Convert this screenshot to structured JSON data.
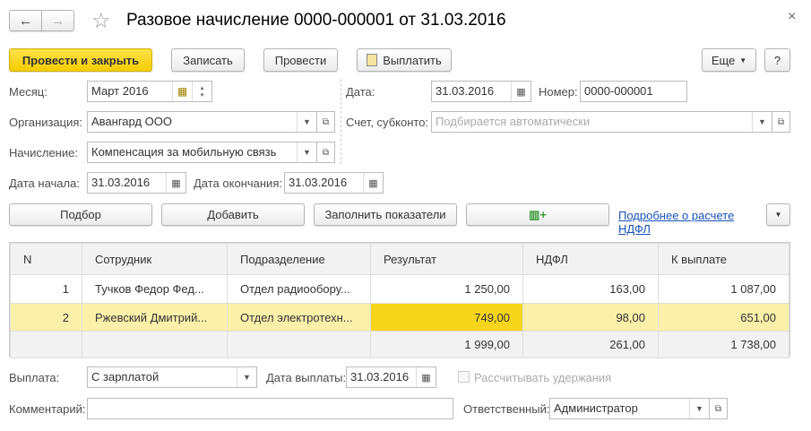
{
  "header": {
    "title": "Разовое начисление 0000-000001 от 31.03.2016",
    "back": "←",
    "forward": "→",
    "close": "×"
  },
  "toolbar": {
    "post_close": "Провести и закрыть",
    "save": "Записать",
    "post": "Провести",
    "pay": "Выплатить",
    "more": "Еще",
    "help": "?"
  },
  "form": {
    "month_label": "Месяц:",
    "month": "Март 2016",
    "date_label": "Дата:",
    "date": "31.03.2016",
    "number_label": "Номер:",
    "number": "0000-000001",
    "org_label": "Организация:",
    "org": "Авангард ООО",
    "account_label": "Счет, субконто:",
    "account_placeholder": "Подбирается автоматически",
    "accrual_label": "Начисление:",
    "accrual": "Компенсация за мобильную связь",
    "start_label": "Дата начала:",
    "start": "31.03.2016",
    "end_label": "Дата окончания:",
    "end": "31.03.2016"
  },
  "actions": {
    "pick": "Подбор",
    "add": "Добавить",
    "fill": "Заполнить показатели",
    "ndfl_link": "Подробнее о расчете НДФЛ"
  },
  "table": {
    "columns": [
      "N",
      "Сотрудник",
      "Подразделение",
      "Результат",
      "НДФЛ",
      "К выплате"
    ],
    "rows": [
      [
        "1",
        "Тучков Федор Фед...",
        "Отдел радиообору...",
        "1 250,00",
        "163,00",
        "1 087,00"
      ],
      [
        "2",
        "Ржевский Дмитрий...",
        "Отдел электротехн...",
        "749,00",
        "98,00",
        "651,00"
      ]
    ],
    "totals": [
      "",
      "",
      "",
      "1 999,00",
      "261,00",
      "1 738,00"
    ]
  },
  "footer": {
    "payout_label": "Выплата:",
    "payout": "С зарплатой",
    "paydate_label": "Дата выплаты:",
    "paydate": "31.03.2016",
    "withhold_label": "Рассчитывать удержания",
    "comment_label": "Комментарий:",
    "comment": "",
    "resp_label": "Ответственный:",
    "resp": "Администратор"
  }
}
